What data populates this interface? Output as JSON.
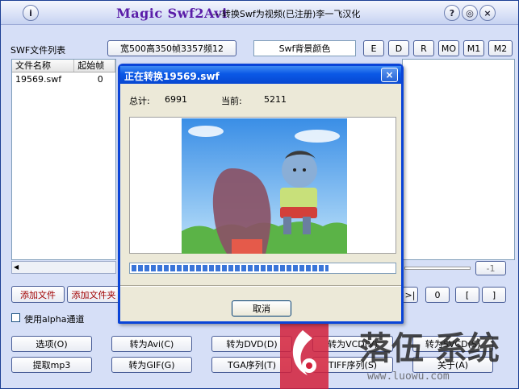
{
  "app": {
    "name": "Magic Swf2Avi",
    "subtitle": "---转换Swf为视频(已注册)李一飞汉化",
    "info_icon": "i",
    "help_icon": "?",
    "minimize_icon": "◎",
    "close_icon": "×"
  },
  "top": {
    "list_label": "SWF文件列表",
    "size_info": "宽500高350帧3357频12",
    "bg_color_label": "Swf背景颜色",
    "mode_buttons": [
      "E",
      "D",
      "R",
      "MO",
      "M1",
      "M2"
    ]
  },
  "file_list": {
    "headers": [
      "文件名称",
      "起始帧"
    ],
    "rows": [
      {
        "name": "19569.swf",
        "start": "0"
      }
    ]
  },
  "nav": {
    "minus_one": "-1",
    "step_buttons": [
      ">|",
      "0",
      "[",
      "]"
    ]
  },
  "actions": {
    "add_file": "添加文件",
    "add_folder": "添加文件夹",
    "alpha_label": "使用alpha通道",
    "row1": [
      "选项(O)",
      "转为Avi(C)",
      "转为DVD(D)",
      "转为VCD(V)",
      "转为SVCD(S)"
    ],
    "row2": [
      "提取mp3",
      "转为GIF(G)",
      "TGA序列(T)",
      "TIFF序列(S)",
      "关于(A)"
    ]
  },
  "dialog": {
    "title": "正在转换19569.swf",
    "close_icon": "×",
    "total_label": "总计:",
    "total_value": "6991",
    "current_label": "当前:",
    "current_value": "5211",
    "cancel": "取消",
    "progress": 0.75
  },
  "watermark": {
    "text": "落伍 系统",
    "url": "www.luowu.com"
  },
  "colors": {
    "accent": "#0a58e6",
    "title_purple": "#5a1da8",
    "watermark_red": "#d2203a"
  }
}
